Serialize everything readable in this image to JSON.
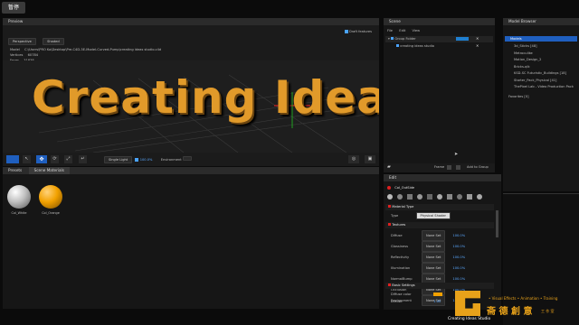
{
  "pause_label": "暂停",
  "preview": {
    "title": "Preview",
    "draft_label": "Draft features",
    "perspective": "Perspective",
    "shaded": "Shaded",
    "model_label": "Model",
    "model_path": "C:\\Users\\PRO Ko\\Desktop\\Pre-C4D-3E-Model-Curved-Pump\\creating ideas studio.c4d",
    "vertices_label": "Vertices",
    "vertices_value": "60784",
    "faces_label": "Faces",
    "faces_value": "31838",
    "viewport_text": "Creating Ideas S",
    "single_light": "Single Light",
    "light_value": "100.0%",
    "environment": "Environment"
  },
  "presets": {
    "tabs": [
      "Presets",
      "Scene Materials"
    ],
    "materials": [
      {
        "name": "Col_White",
        "color": "#bfbfbf"
      },
      {
        "name": "Col_Orange",
        "color": "#f2a100"
      }
    ]
  },
  "scene": {
    "title": "Scene",
    "menu": [
      "File",
      "Edit",
      "View"
    ],
    "tree": [
      {
        "label": "Group Folder"
      },
      {
        "label": "creating ideas studio"
      }
    ],
    "footer_items": [
      "Frame",
      "Add to Group"
    ]
  },
  "browser": {
    "title": "Model Browser",
    "items": [
      "Models",
      "3d_Sticks [48]",
      "Metroculike",
      "Motion_Design_2",
      "Bricks-qlk",
      "KSD-SC Futuristic_Buildings [18]",
      "Starter_Pack_Physical [41]",
      "ThePixel Lab - Video Production Pack",
      "Favorites [0]"
    ]
  },
  "edit": {
    "title": "Edit",
    "material_name": "Col_OutSide",
    "section_material_type": "Material Type",
    "type_label": "Type",
    "type_value": "Physical Shader",
    "section_textures": "Textures",
    "textures": [
      {
        "label": "Diffuse",
        "btn": "None Set",
        "value": "100.0%"
      },
      {
        "label": "Glossiness",
        "btn": "None Set",
        "value": "100.0%"
      },
      {
        "label": "Reflectivity",
        "btn": "None Set",
        "value": "100.0%"
      },
      {
        "label": "Illumination",
        "btn": "None Set",
        "value": "100.0%"
      },
      {
        "label": "NormalBump",
        "btn": "None Set",
        "value": "100.0%"
      },
      {
        "label": "Occlusion",
        "btn": "None Set",
        "value": "100.0%"
      },
      {
        "label": "Environment",
        "btn": "None Set",
        "value": "100.0%"
      }
    ],
    "section_basic": "Basic Settings",
    "diffuse_color_label": "Diffuse color",
    "diffuse_color": "#f2a100",
    "diffuse_label": "Diffuse",
    "diffuse_value": "1.00"
  },
  "watermark": {
    "text1": "• Visual Effects • Animation • Training",
    "text2": "斋 德 創 意",
    "text3": "工 作 室",
    "studio": "Creating Ideas Studio"
  }
}
